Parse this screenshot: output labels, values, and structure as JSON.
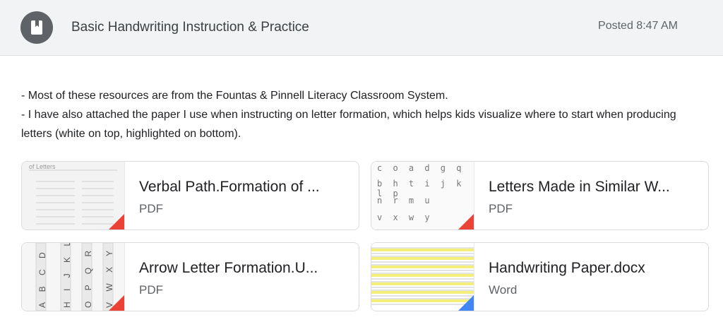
{
  "header": {
    "title": "Basic Handwriting Instruction & Practice",
    "posted": "Posted 8:47 AM",
    "icon": "assignment-book-icon"
  },
  "description": {
    "line1": "- Most of these resources are from the Fountas & Pinnell Literacy Classroom System.",
    "line2": "- I have also attached the paper I use when instructing on letter formation, which helps kids visualize where to start when producing letters (white on top, highlighted on bottom)."
  },
  "attachments": [
    {
      "title": "Verbal Path.Formation of ...",
      "type": "PDF",
      "accent": "#ea4335"
    },
    {
      "title": "Letters Made in Similar W...",
      "type": "PDF",
      "accent": "#ea4335"
    },
    {
      "title": "Arrow Letter Formation.U...",
      "type": "PDF",
      "accent": "#ea4335"
    },
    {
      "title": "Handwriting Paper.docx",
      "type": "Word",
      "accent": "#4285f4"
    }
  ],
  "thumbs": {
    "verbal_heading": "of Letters",
    "similar_rows": [
      "c o a d g q",
      "b h t i j k l p",
      "n r m u",
      "v x w y"
    ],
    "arrow_cols": [
      "A B C D E",
      "H I J K L M N",
      "O P Q R S T U",
      "V W X Y Z"
    ]
  }
}
